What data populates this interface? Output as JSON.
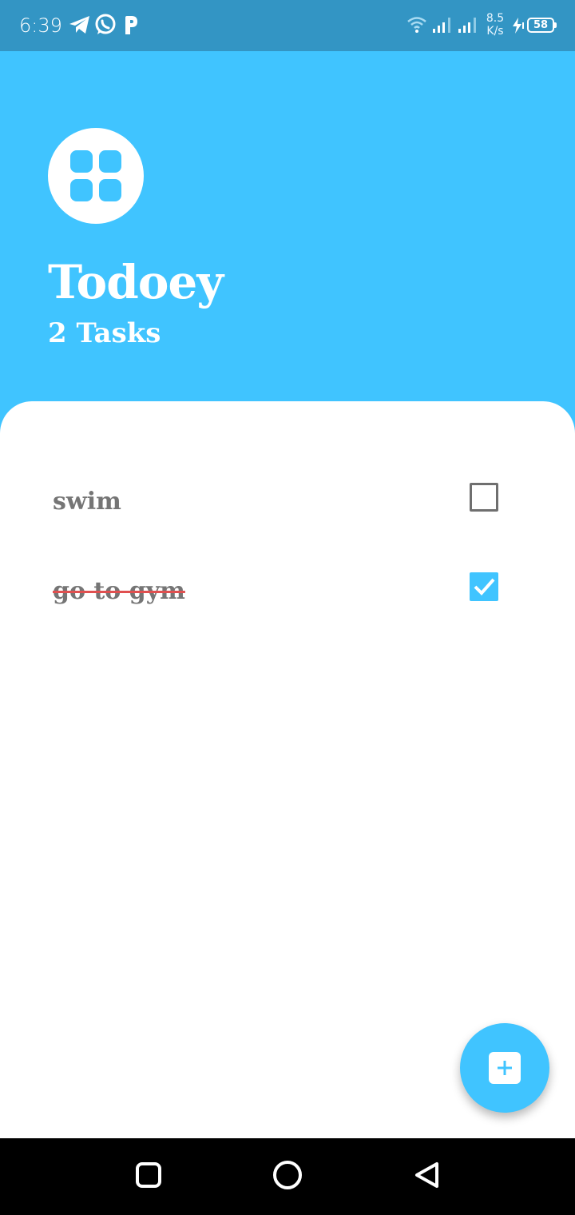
{
  "status_bar": {
    "time": "6:39",
    "speed_value": "8.5",
    "speed_unit": "K/s",
    "battery": "58",
    "icons": [
      "telegram-icon",
      "whatsapp-icon",
      "p-app-icon",
      "wifi-icon",
      "signal-icon",
      "signal-icon",
      "charging-icon"
    ]
  },
  "header": {
    "app_icon": "grid-apps-icon",
    "title": "Todoey",
    "task_count": "2 Tasks"
  },
  "tasks": [
    {
      "title": "swim",
      "done": false
    },
    {
      "title": "go to gym",
      "done": true
    }
  ],
  "fab": {
    "icon": "add-icon"
  },
  "navbar": {
    "icons": [
      "recents-square-icon",
      "home-circle-icon",
      "back-triangle-icon"
    ]
  },
  "colors": {
    "primary": "#40c4ff",
    "status_bar": "#3395c4",
    "task_text": "#757575",
    "strike": "#e05050"
  }
}
